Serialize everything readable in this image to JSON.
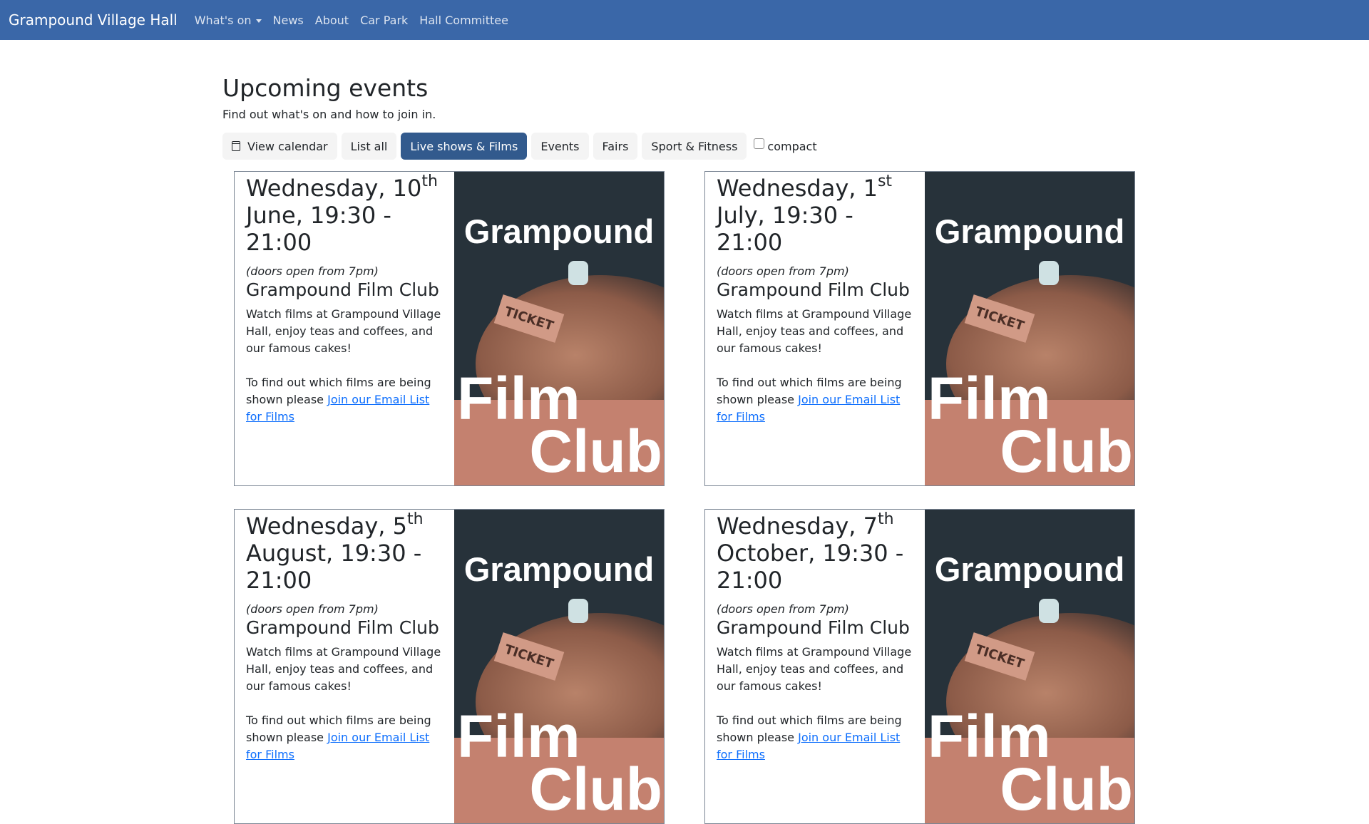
{
  "nav": {
    "brand": "Grampound Village Hall",
    "items": [
      "What's on",
      "News",
      "About",
      "Car Park",
      "Hall Committee"
    ]
  },
  "page": {
    "title": "Upcoming events",
    "lead": "Find out what's on and how to join in."
  },
  "filters": {
    "calendar": "View calendar",
    "list_all": "List all",
    "live": "Live shows & Films",
    "events": "Events",
    "fairs": "Fairs",
    "sport": "Sport & Fitness",
    "compact": "compact"
  },
  "poster": {
    "top": "Grampound",
    "ticket": "TICKET",
    "film": "Film",
    "club": "Club"
  },
  "events": [
    {
      "day": "Wednesday, 10",
      "suffix": "th",
      "rest": "June, 19:30 - 21:00",
      "doors": "(doors open from 7pm)",
      "title": "Grampound Film Club",
      "desc": "Watch films at Grampound Village Hall, enjoy teas and coffees, and our famous cakes!",
      "more": "To find out which films are being shown please ",
      "link": "Join our Email List for Films"
    },
    {
      "day": "Wednesday, 1",
      "suffix": "st",
      "rest": "July, 19:30 - 21:00",
      "doors": "(doors open from 7pm)",
      "title": "Grampound Film Club",
      "desc": "Watch films at Grampound Village Hall, enjoy teas and coffees, and our famous cakes!",
      "more": "To find out which films are being shown please ",
      "link": "Join our Email List for Films"
    },
    {
      "day": "Wednesday, 5",
      "suffix": "th",
      "rest": "August, 19:30 - 21:00",
      "doors": "(doors open from 7pm)",
      "title": "Grampound Film Club",
      "desc": "Watch films at Grampound Village Hall, enjoy teas and coffees, and our famous cakes!",
      "more": "To find out which films are being shown please ",
      "link": "Join our Email List for Films"
    },
    {
      "day": "Wednesday, 7",
      "suffix": "th",
      "rest": "October, 19:30 - 21:00",
      "doors": "(doors open from 7pm)",
      "title": "Grampound Film Club",
      "desc": "Watch films at Grampound Village Hall, enjoy teas and coffees, and our famous cakes!",
      "more": "To find out which films are being shown please ",
      "link": "Join our Email List for Films"
    }
  ],
  "colors": {
    "navbar": "#3a67a8",
    "active_filter": "#325a8d",
    "link": "#0d6efd",
    "poster_dark": "#27323a",
    "poster_band": "#c4816f"
  }
}
